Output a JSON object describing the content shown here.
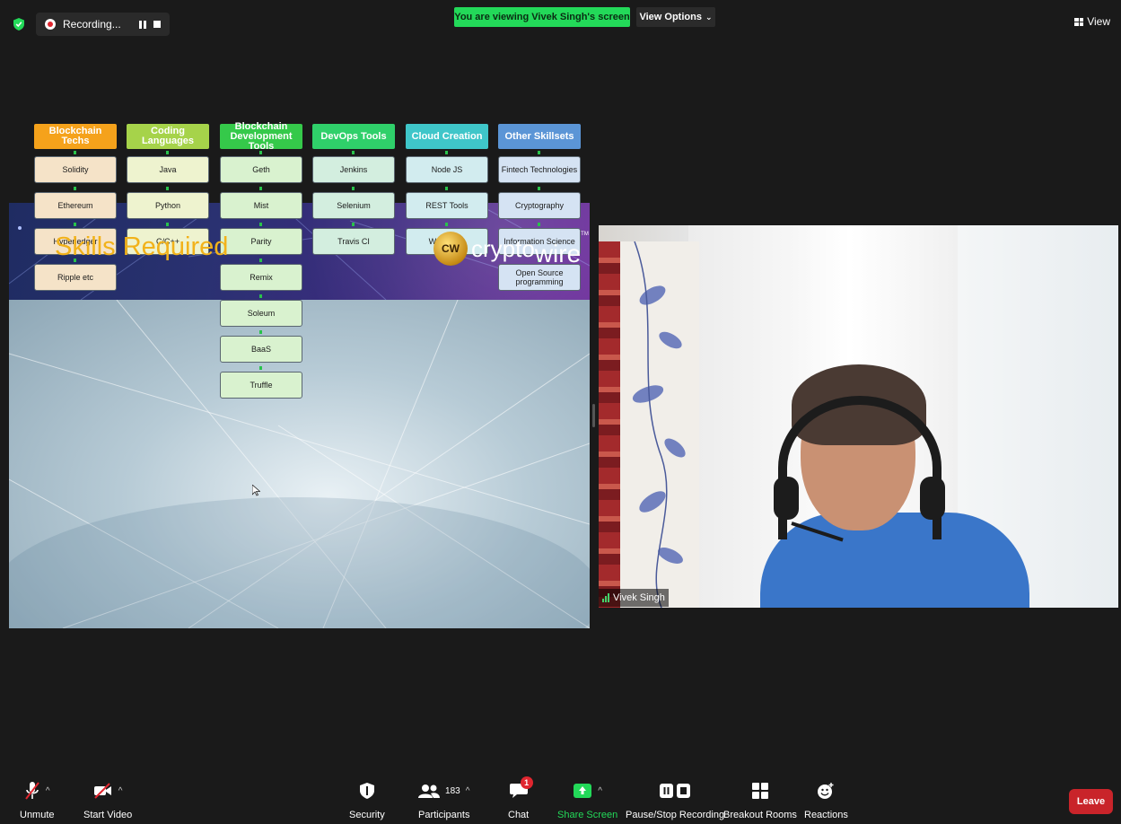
{
  "top_bar": {
    "recording_label": "Recording...",
    "viewing_banner": "You are viewing Vivek Singh's screen",
    "view_options_label": "View Options",
    "view_label": "View"
  },
  "slide": {
    "title": "Skills Required",
    "logo": {
      "coin_text": "CW",
      "brand_main": "crypto",
      "brand_sub": "wire",
      "trademark": "TM"
    },
    "columns": [
      {
        "category": "Blockchain Techs",
        "color": "#f5a21b",
        "items": [
          "Solidity",
          "Ethereum",
          "Hyperledger",
          "Ripple etc"
        ],
        "item_bg": "#f5e3c8"
      },
      {
        "category": "Coding Languages",
        "color": "#a6d34a",
        "items": [
          "Java",
          "Python",
          "C/C++"
        ],
        "item_bg": "#eef3cf"
      },
      {
        "category": "Blockchain Development Tools",
        "color": "#35c94a",
        "items": [
          "Geth",
          "Mist",
          "Parity",
          "Remix",
          "Soleum",
          "BaaS",
          "Truffle"
        ],
        "item_bg": "#d9f2cf"
      },
      {
        "category": "DevOps Tools",
        "color": "#2fd06a",
        "items": [
          "Jenkins",
          "Selenium",
          "Travis CI"
        ],
        "item_bg": "#d3eedf"
      },
      {
        "category": "Cloud Creation",
        "color": "#3fc6c9",
        "items": [
          "Node JS",
          "REST Tools",
          "Web Apps"
        ],
        "item_bg": "#d2ecef"
      },
      {
        "category": "Other Skillsets",
        "color": "#5b95d6",
        "items": [
          "Fintech Technologies",
          "Cryptography",
          "Information Science",
          "Open Source programming"
        ],
        "item_bg": "#d5e3f3"
      }
    ]
  },
  "video": {
    "participant_name": "Vivek Singh"
  },
  "toolbar": {
    "unmute_label": "Unmute",
    "start_video_label": "Start Video",
    "security_label": "Security",
    "participants_label": "Participants",
    "participants_count": "183",
    "chat_label": "Chat",
    "chat_badge": "1",
    "share_screen_label": "Share Screen",
    "pause_stop_recording_label": "Pause/Stop Recording",
    "breakout_rooms_label": "Breakout Rooms",
    "reactions_label": "Reactions",
    "leave_label": "Leave"
  },
  "colors": {
    "share_green": "#23d959",
    "leave_red": "#c9242a",
    "title_gold": "#f2b21a"
  }
}
